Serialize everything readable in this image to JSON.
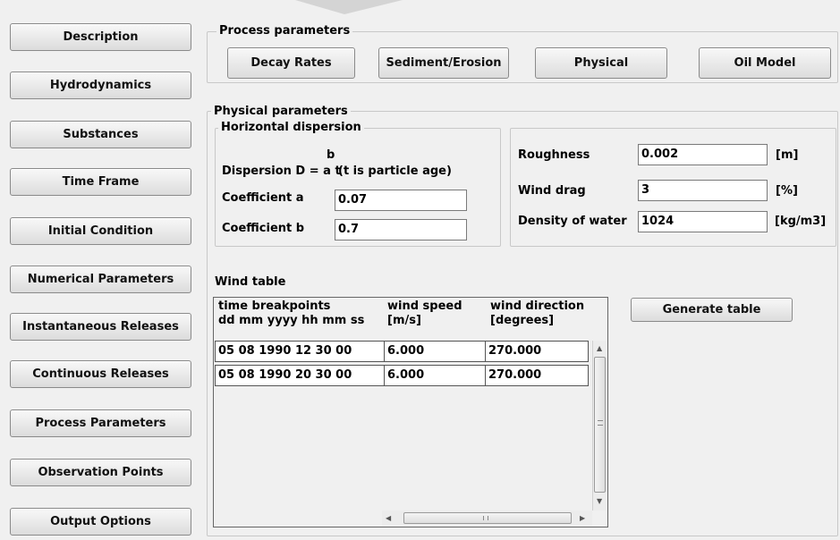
{
  "nav": [
    {
      "label": "Description"
    },
    {
      "label": "Hydrodynamics"
    },
    {
      "label": "Substances"
    },
    {
      "label": "Time Frame"
    },
    {
      "label": "Initial Condition"
    },
    {
      "label": "Numerical Parameters"
    },
    {
      "label": "Instantaneous Releases"
    },
    {
      "label": "Continuous Releases"
    },
    {
      "label": "Process Parameters"
    },
    {
      "label": "Observation Points"
    },
    {
      "label": "Output Options"
    }
  ],
  "process": {
    "title": "Process parameters",
    "buttons": [
      {
        "label": "Decay Rates"
      },
      {
        "label": "Sediment/Erosion"
      },
      {
        "label": "Physical"
      },
      {
        "label": "Oil Model"
      }
    ]
  },
  "physical": {
    "title": "Physical parameters",
    "horizontal": {
      "title": "Horizontal dispersion",
      "exponent": "b",
      "formula": "Dispersion D = a t",
      "note": "(t is particle age)",
      "coef_a_label": "Coefficient a",
      "coef_a_value": "0.07",
      "coef_b_label": "Coefficient b",
      "coef_b_value": "0.7"
    },
    "roughness_label": "Roughness",
    "roughness_value": "0.002",
    "roughness_unit": "[m]",
    "wind_drag_label": "Wind drag",
    "wind_drag_value": "3",
    "wind_drag_unit": "[%]",
    "density_label": "Density of water",
    "density_value": "1024",
    "density_unit": "[kg/m3]"
  },
  "wind_table": {
    "title": "Wind table",
    "headers": [
      {
        "line1": "time breakpoints",
        "line2": "dd mm yyyy hh mm ss"
      },
      {
        "line1": "wind speed",
        "line2": "[m/s]"
      },
      {
        "line1": "wind direction",
        "line2": "[degrees]"
      }
    ],
    "rows": [
      [
        "05 08 1990 12 30 00",
        "6.000",
        "270.000"
      ],
      [
        "05 08 1990 20 30 00",
        "6.000",
        "270.000"
      ]
    ],
    "generate_label": "Generate table"
  }
}
